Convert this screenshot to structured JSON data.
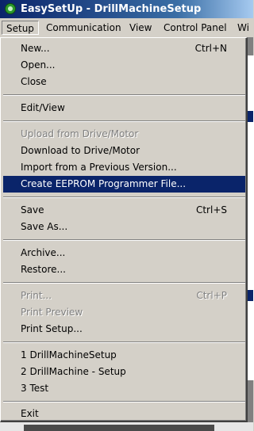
{
  "window": {
    "title": "EasySetUp - DrillMachineSetup"
  },
  "menubar": {
    "items": [
      "Setup",
      "Communication",
      "View",
      "Control Panel",
      "Wi"
    ]
  },
  "setup_menu": {
    "items": [
      {
        "label": "New...",
        "shortcut": "Ctrl+N",
        "enabled": true
      },
      {
        "label": "Open...",
        "shortcut": "",
        "enabled": true
      },
      {
        "label": "Close",
        "shortcut": "",
        "enabled": true
      },
      {
        "label": "Edit/View",
        "shortcut": "",
        "enabled": true
      },
      {
        "label": "Upload from Drive/Motor",
        "shortcut": "",
        "enabled": false
      },
      {
        "label": "Download to Drive/Motor",
        "shortcut": "",
        "enabled": true
      },
      {
        "label": "Import from a Previous Version...",
        "shortcut": "",
        "enabled": true
      },
      {
        "label": "Create EEPROM Programmer File...",
        "shortcut": "",
        "enabled": true,
        "highlighted": true
      },
      {
        "label": "Save",
        "shortcut": "Ctrl+S",
        "enabled": true
      },
      {
        "label": "Save As...",
        "shortcut": "",
        "enabled": true
      },
      {
        "label": "Archive...",
        "shortcut": "",
        "enabled": true
      },
      {
        "label": "Restore...",
        "shortcut": "",
        "enabled": true
      },
      {
        "label": "Print...",
        "shortcut": "Ctrl+P",
        "enabled": false
      },
      {
        "label": "Print Preview",
        "shortcut": "",
        "enabled": false
      },
      {
        "label": "Print Setup...",
        "shortcut": "",
        "enabled": true
      },
      {
        "label": "1 DrillMachineSetup",
        "shortcut": "",
        "enabled": true
      },
      {
        "label": "2 DrillMachine - Setup",
        "shortcut": "",
        "enabled": true
      },
      {
        "label": "3 Test",
        "shortcut": "",
        "enabled": true
      },
      {
        "label": "Exit",
        "shortcut": "",
        "enabled": true
      }
    ]
  },
  "colors": {
    "title_bar_start": "#0a246a",
    "highlight": "#0a246a",
    "menu_background": "#d4d0c8",
    "disabled_text": "#808080"
  },
  "icons": {
    "app": "green-globe-icon"
  }
}
